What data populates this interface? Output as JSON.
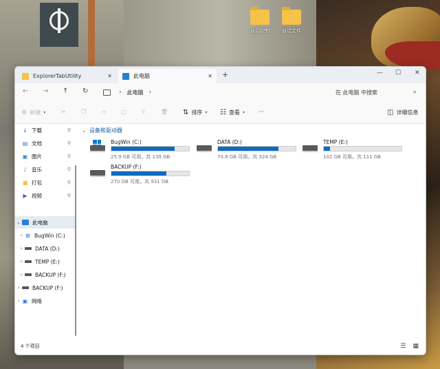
{
  "desktop": {
    "icons": [
      {
        "label": "自动控制"
      },
      {
        "label": "自动文件"
      }
    ]
  },
  "window": {
    "tabs": [
      {
        "label": "ExplorerTabUtility",
        "icon": "folder-icon"
      },
      {
        "label": "此电脑",
        "icon": "this-pc-icon"
      }
    ],
    "new_tab": "+",
    "controls": {
      "minimize": "—",
      "maximize": "☐",
      "close": "✕"
    }
  },
  "nav": {
    "back": "←",
    "forward": "→",
    "up": "↑",
    "refresh": "↻",
    "address": {
      "segments": [
        "此电脑"
      ],
      "chevron": "›"
    },
    "search": {
      "placeholder": "在 此电脑 中搜索",
      "icon": "⌕"
    }
  },
  "toolbar": {
    "new_label": "新建",
    "sort_label": "排序",
    "view_label": "查看",
    "more_label": "···",
    "details_label": "详细信息"
  },
  "sidebar": {
    "quick": [
      {
        "label": "下载",
        "icon": "download-icon",
        "glyph": "↓",
        "color": "#1f7bd1"
      },
      {
        "label": "文档",
        "icon": "document-icon",
        "glyph": "▤",
        "color": "#4d7fb4"
      },
      {
        "label": "图片",
        "icon": "picture-icon",
        "glyph": "▣",
        "color": "#2c8bd8"
      },
      {
        "label": "音乐",
        "icon": "music-icon",
        "glyph": "♪",
        "color": "#e07b2c"
      },
      {
        "label": "打包",
        "icon": "folder-icon",
        "glyph": "■",
        "color": "#f5c34a"
      },
      {
        "label": "视频",
        "icon": "video-icon",
        "glyph": "▶",
        "color": "#6a52c8"
      }
    ],
    "pin": "📌",
    "this_pc": "此电脑",
    "drives": [
      "BugWin (C:)",
      "DATA (D:)",
      "TEMP (E:)",
      "BACKUP (F:)"
    ],
    "extra": [
      "BACKUP (F:)",
      "网络"
    ]
  },
  "content": {
    "group_title": "设备和驱动器",
    "drives": [
      {
        "name": "BugWin (C:)",
        "info": "25.9 GB 可用，共 139 GB",
        "used_fraction": 0.81,
        "icon": "windows-drive-icon"
      },
      {
        "name": "DATA (D:)",
        "info": "70.8 GB 可用，共 324 GB",
        "used_fraction": 0.78,
        "icon": "drive-icon"
      },
      {
        "name": "TEMP (E:)",
        "info": "102 GB 可用，共 111 GB",
        "used_fraction": 0.08,
        "icon": "drive-icon"
      },
      {
        "name": "BACKUP (F:)",
        "info": "270 GB 可用，共 931 GB",
        "used_fraction": 0.71,
        "icon": "drive-icon"
      }
    ]
  },
  "status": {
    "text": "4 个项目",
    "list_view": "☰",
    "tile_view": "▦"
  },
  "colors": {
    "accent": "#0e6ac2",
    "selection": "#e5ebf1"
  }
}
